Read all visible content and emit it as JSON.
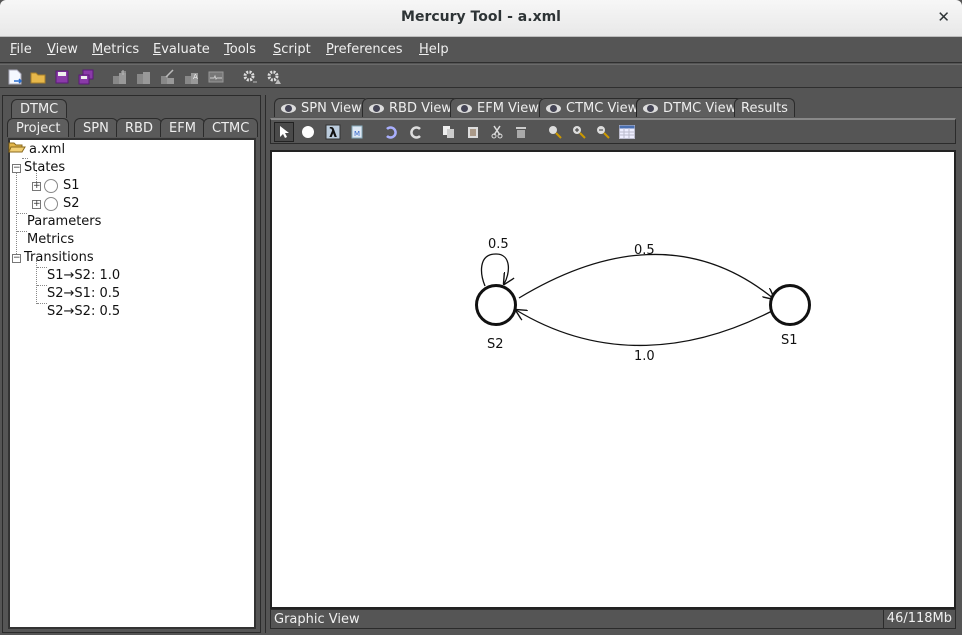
{
  "window": {
    "title": "Mercury Tool - a.xml",
    "close_icon": "close-icon"
  },
  "menu": [
    {
      "label": "File",
      "mnemonic": "F",
      "rest": "ile"
    },
    {
      "label": "View",
      "mnemonic": "V",
      "rest": "iew"
    },
    {
      "label": "Metrics",
      "mnemonic": "M",
      "rest": "etrics"
    },
    {
      "label": "Evaluate",
      "mnemonic": "E",
      "rest": "valuate"
    },
    {
      "label": "Tools",
      "mnemonic": "T",
      "rest": "ools"
    },
    {
      "label": "Script",
      "mnemonic": "S",
      "rest": "cript"
    },
    {
      "label": "Preferences",
      "mnemonic": "P",
      "rest": "references"
    },
    {
      "label": "Help",
      "mnemonic": "H",
      "rest": "elp"
    }
  ],
  "toolbar": {
    "icons": [
      "new-file-icon",
      "open-folder-icon",
      "save-icon",
      "save-all-icon",
      "add-module-icon",
      "remove-module-icon",
      "edit-module-icon",
      "module-info-icon",
      "waveform-icon",
      "settings-run-icon",
      "settings-warning-icon"
    ]
  },
  "left_panel": {
    "top_tab": "DTMC",
    "tabs": [
      "Project",
      "SPN",
      "RBD",
      "EFM",
      "CTMC"
    ],
    "tree": {
      "root": "a.xml",
      "states_label": "States",
      "states": [
        "S1",
        "S2"
      ],
      "parameters_label": "Parameters",
      "metrics_label": "Metrics",
      "transitions_label": "Transitions",
      "transitions": [
        "S1→S2: 1.0",
        "S2→S1: 0.5",
        "S2→S2: 0.5"
      ]
    }
  },
  "right_panel": {
    "tabs": [
      "SPN View",
      "RBD View",
      "EFM View",
      "CTMC View",
      "DTMC View",
      "Results"
    ],
    "active_tab": "DTMC View",
    "view_toolbar": [
      "select-pointer-icon",
      "add-state-icon",
      "lambda-icon",
      "metrics-doc-icon",
      "undo-icon",
      "redo-icon",
      "copy-icon",
      "paste-icon",
      "cut-icon",
      "delete-icon",
      "zoom-icon",
      "zoom-in-icon",
      "zoom-out-icon",
      "table-icon"
    ],
    "graph": {
      "states": [
        {
          "id": "S2",
          "label": "S2"
        },
        {
          "id": "S1",
          "label": "S1"
        }
      ],
      "edges": [
        {
          "from": "S2",
          "to": "S2",
          "label": "0.5"
        },
        {
          "from": "S2",
          "to": "S1",
          "label": "0.5"
        },
        {
          "from": "S1",
          "to": "S2",
          "label": "1.0"
        }
      ]
    },
    "status_left": "Graphic View",
    "status_right": "46/118Mb"
  }
}
